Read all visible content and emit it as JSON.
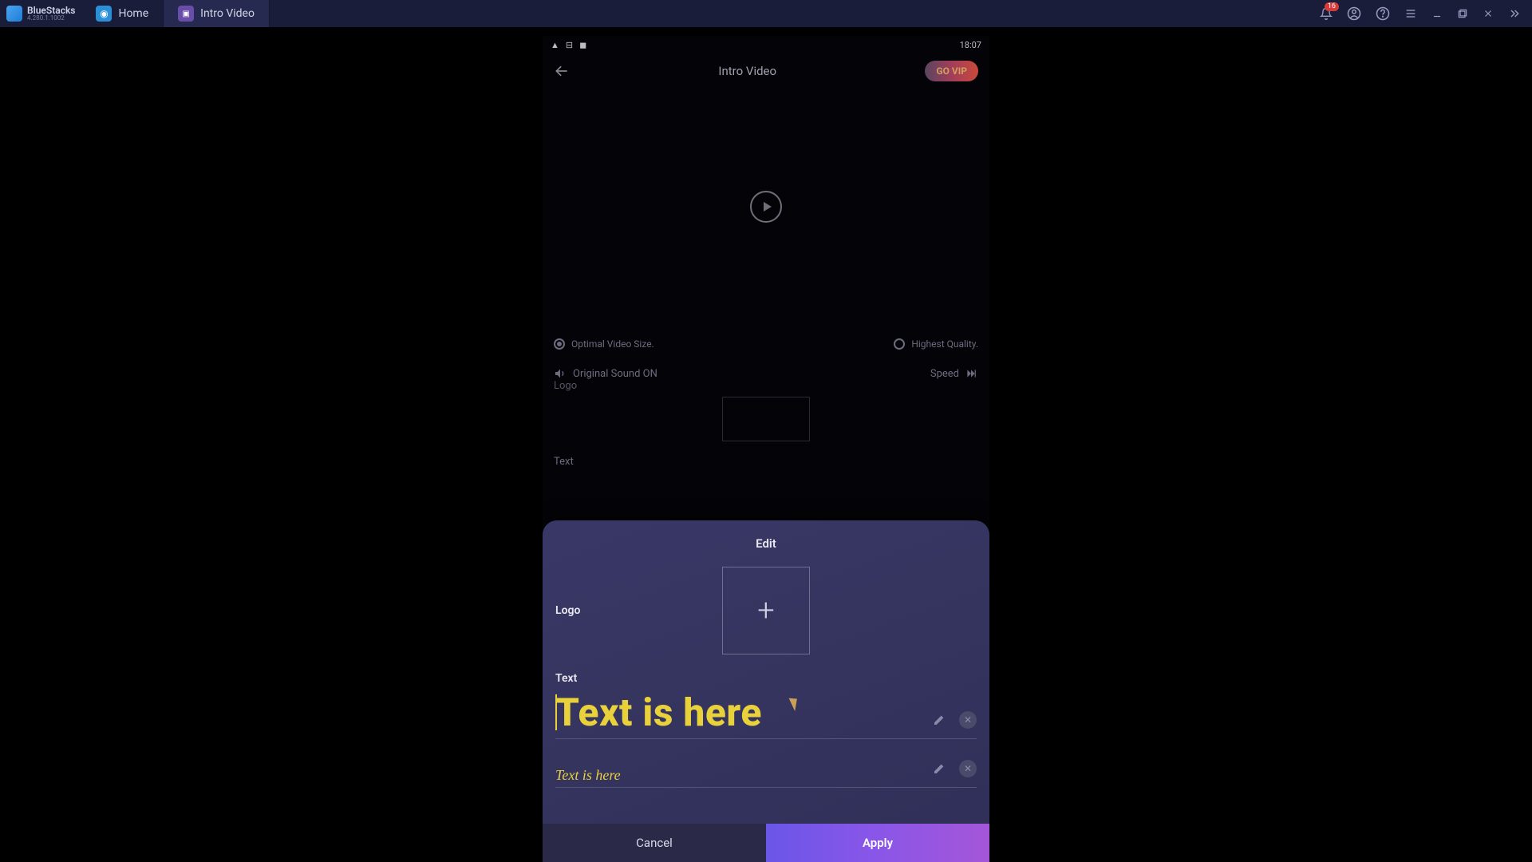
{
  "titlebar": {
    "app_name": "BlueStacks",
    "version": "4.280.1.1002",
    "tabs": [
      {
        "label": "Home"
      },
      {
        "label": "Intro Video"
      }
    ],
    "notification_count": "16"
  },
  "phone": {
    "status_time": "18:07",
    "header_title": "Intro Video",
    "vip_label": "GO VIP",
    "radio_optimal": "Optimal Video Size.",
    "radio_highest": "Highest Quality.",
    "sound_label": "Original Sound ON",
    "speed_label": "Speed",
    "logo_label": "Logo",
    "text_label": "Text"
  },
  "sheet": {
    "title": "Edit",
    "logo_label": "Logo",
    "text_label": "Text",
    "text1": "Text is here",
    "text2": "Text is here",
    "cancel_label": "Cancel",
    "apply_label": "Apply"
  }
}
